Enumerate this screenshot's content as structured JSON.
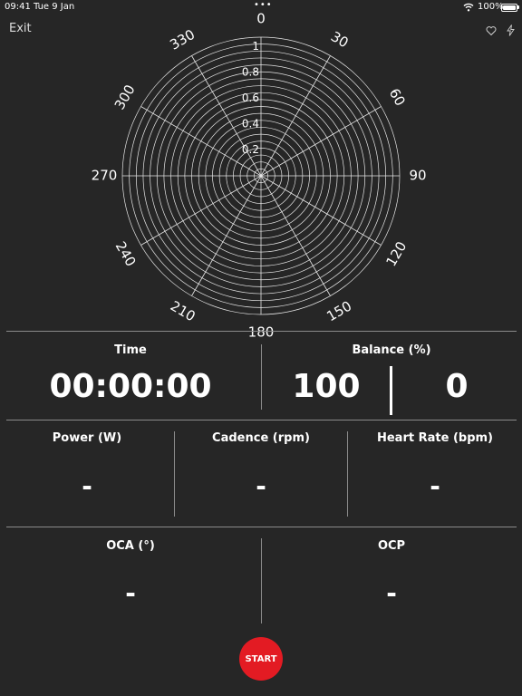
{
  "status_bar": {
    "time": "09:41",
    "date": "Tue 9 Jan",
    "dots": "•••",
    "battery": "100%"
  },
  "header": {
    "exit_label": "Exit",
    "icons": [
      "heart-icon",
      "bolt-icon"
    ]
  },
  "polar_chart": {
    "angle_labels": [
      "0",
      "30",
      "60",
      "90",
      "120",
      "150",
      "180",
      "210",
      "240",
      "270",
      "300",
      "330"
    ],
    "radial_labels": [
      "0.2",
      "0.4",
      "0.6",
      "0.8",
      "1"
    ]
  },
  "time": {
    "label": "Time",
    "value": "00:00:00"
  },
  "balance": {
    "label": "Balance (%)",
    "left": "100",
    "right": "0"
  },
  "power": {
    "label": "Power (W)",
    "value": "-"
  },
  "cadence": {
    "label": "Cadence (rpm)",
    "value": "-"
  },
  "heart_rate": {
    "label": "Heart Rate (bpm)",
    "value": "-"
  },
  "oca": {
    "label": "OCA (°)",
    "value": "-"
  },
  "ocp": {
    "label": "OCP",
    "value": "-"
  },
  "start_button": {
    "label": "START"
  },
  "colors": {
    "background": "#262626",
    "start": "#e31b23",
    "text": "#ffffff"
  }
}
